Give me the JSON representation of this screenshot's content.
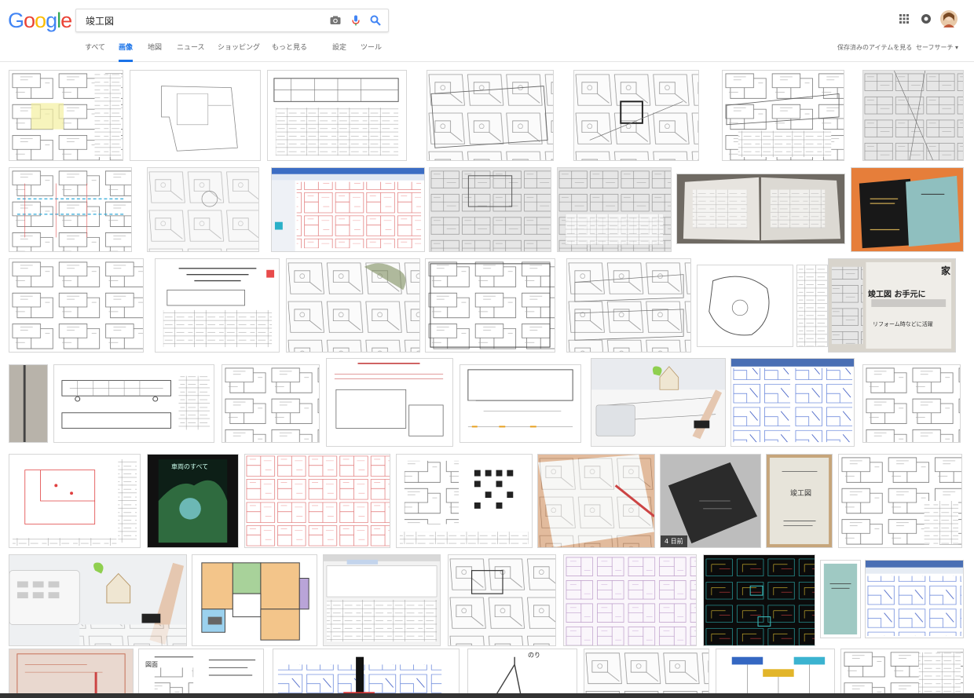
{
  "logo": {
    "letters": [
      "G",
      "o",
      "o",
      "g",
      "l",
      "e"
    ],
    "colors": [
      "#4285F4",
      "#EA4335",
      "#FBBC05",
      "#4285F4",
      "#34A853",
      "#EA4335"
    ]
  },
  "search": {
    "value": "竣工図",
    "camera_icon": "camera-icon",
    "mic_icon": "mic-icon",
    "search_icon": "search-icon"
  },
  "tabs": [
    {
      "label": "すべて",
      "active": false
    },
    {
      "label": "画像",
      "active": true
    },
    {
      "label": "地図",
      "active": false
    },
    {
      "label": "ニュース",
      "active": false
    },
    {
      "label": "ショッピング",
      "active": false
    },
    {
      "label": "もっと見る",
      "active": false
    },
    {
      "label": "設定",
      "active": false
    },
    {
      "label": "ツール",
      "active": false
    }
  ],
  "header_right": {
    "saved_items": "保存済みのアイテムを見る",
    "safesearch": "セーフサーチ ▾",
    "apps_icon": "apps-grid-icon",
    "notify_icon": "notifications-icon",
    "avatar": "user-avatar"
  },
  "thumbs": {
    "t23_text": "家",
    "t23_sub": "竣工図 お手元に",
    "t23_sub2": "リフォーム時などに活躍",
    "t33_text": "車両のすべて",
    "t37_badge": "4 日前",
    "t38_title": "竣工図",
    "t42_text": "図面",
    "t48_text": "のり"
  }
}
